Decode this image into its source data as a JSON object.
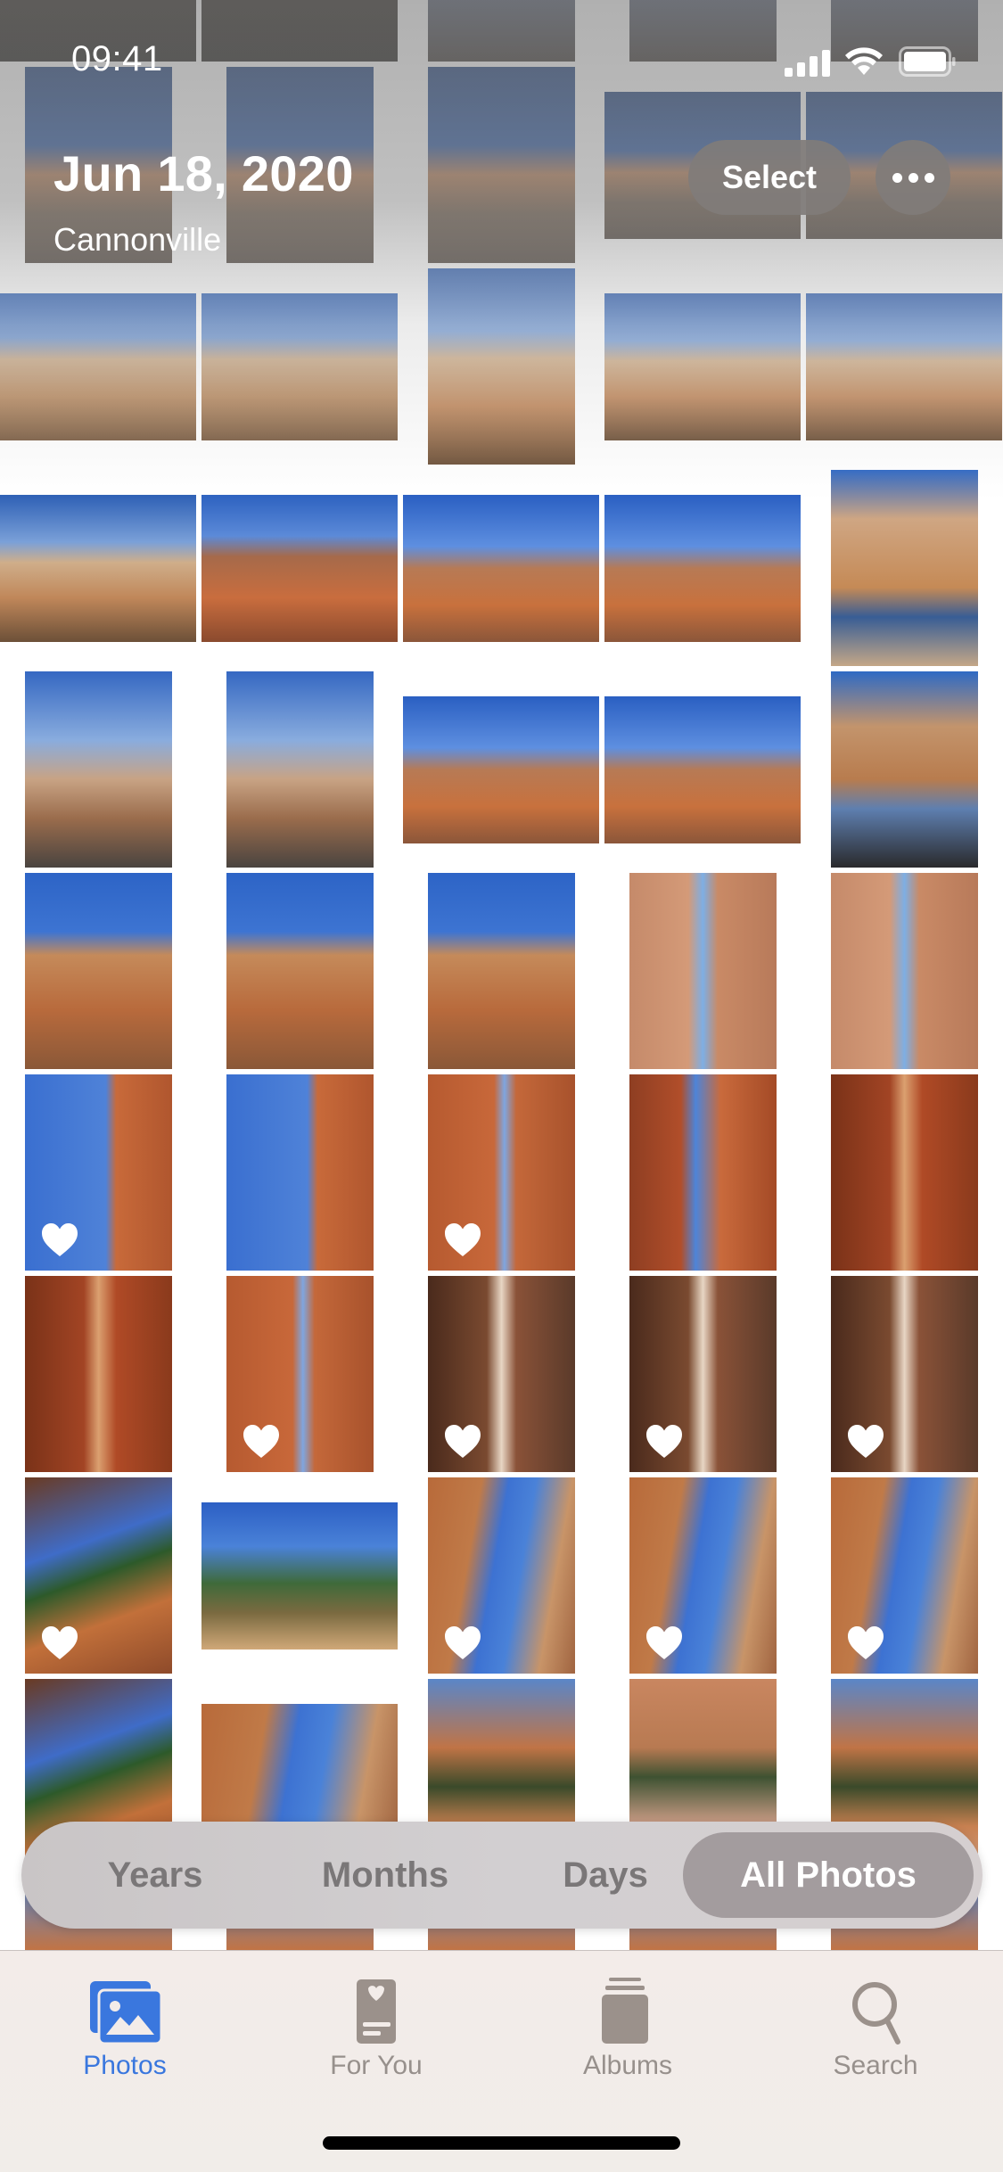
{
  "status_bar": {
    "time": "09:41",
    "signal_icon": "cellular-signal-icon",
    "wifi_icon": "wifi-icon",
    "battery_icon": "battery-icon"
  },
  "header": {
    "date": "Jun 18, 2020",
    "location": "Cannonville",
    "select_label": "Select",
    "more_icon": "ellipsis-icon"
  },
  "grid": {
    "photos": [
      {
        "row": -1,
        "col": 0,
        "fit": "full",
        "scene": "dusk-ground",
        "favorite": false
      },
      {
        "row": -1,
        "col": 1,
        "fit": "full",
        "scene": "dusk-ground",
        "favorite": false
      },
      {
        "row": -1,
        "col": 2,
        "fit": "portrait",
        "scene": "person-log",
        "favorite": false
      },
      {
        "row": -1,
        "col": 3,
        "fit": "portrait",
        "scene": "person-log",
        "favorite": false
      },
      {
        "row": -1,
        "col": 4,
        "fit": "portrait",
        "scene": "person-log",
        "favorite": false
      },
      {
        "row": 0,
        "col": 0,
        "fit": "portrait",
        "scene": "person-overlook",
        "favorite": false
      },
      {
        "row": 0,
        "col": 1,
        "fit": "portrait",
        "scene": "person-overlook",
        "favorite": false
      },
      {
        "row": 0,
        "col": 2,
        "fit": "portrait",
        "scene": "person-overlook",
        "favorite": false
      },
      {
        "row": 0,
        "col": 3,
        "fit": "landscape",
        "scene": "person-overlook",
        "favorite": false
      },
      {
        "row": 0,
        "col": 4,
        "fit": "landscape",
        "scene": "person-overlook",
        "favorite": false
      },
      {
        "row": 1,
        "col": 0,
        "fit": "landscape",
        "scene": "amphitheater-person",
        "favorite": false
      },
      {
        "row": 1,
        "col": 1,
        "fit": "landscape",
        "scene": "amphitheater-person",
        "favorite": false
      },
      {
        "row": 1,
        "col": 2,
        "fit": "portrait",
        "scene": "amphitheater",
        "favorite": false
      },
      {
        "row": 1,
        "col": 3,
        "fit": "landscape",
        "scene": "amphitheater",
        "favorite": false
      },
      {
        "row": 1,
        "col": 4,
        "fit": "landscape",
        "scene": "amphitheater",
        "favorite": false
      },
      {
        "row": 2,
        "col": 0,
        "fit": "landscape",
        "scene": "amphitheater",
        "favorite": false
      },
      {
        "row": 2,
        "col": 1,
        "fit": "landscape",
        "scene": "hoodoo-wall",
        "favorite": false
      },
      {
        "row": 2,
        "col": 2,
        "fit": "landscape",
        "scene": "hoodoo-clouds",
        "favorite": false
      },
      {
        "row": 2,
        "col": 3,
        "fit": "landscape",
        "scene": "hoodoo-clouds",
        "favorite": false
      },
      {
        "row": 2,
        "col": 4,
        "fit": "portrait",
        "scene": "railing-view",
        "favorite": false
      },
      {
        "row": 3,
        "col": 0,
        "fit": "portrait",
        "scene": "trail-descent",
        "favorite": false
      },
      {
        "row": 3,
        "col": 1,
        "fit": "portrait",
        "scene": "trail-descent",
        "favorite": false
      },
      {
        "row": 3,
        "col": 2,
        "fit": "landscape",
        "scene": "hoodoo-clouds",
        "favorite": false
      },
      {
        "row": 3,
        "col": 3,
        "fit": "landscape",
        "scene": "hoodoo-clouds",
        "favorite": false
      },
      {
        "row": 3,
        "col": 4,
        "fit": "portrait",
        "scene": "two-people",
        "favorite": false
      },
      {
        "row": 4,
        "col": 0,
        "fit": "portrait",
        "scene": "canyon-sky",
        "favorite": false
      },
      {
        "row": 4,
        "col": 1,
        "fit": "portrait",
        "scene": "canyon-sky",
        "favorite": false
      },
      {
        "row": 4,
        "col": 2,
        "fit": "portrait",
        "scene": "canyon-sky",
        "favorite": false
      },
      {
        "row": 4,
        "col": 3,
        "fit": "portrait",
        "scene": "slot-rock",
        "favorite": false
      },
      {
        "row": 4,
        "col": 4,
        "fit": "portrait",
        "scene": "slot-rock",
        "favorite": false
      },
      {
        "row": 5,
        "col": 0,
        "fit": "portrait",
        "scene": "slot-blue",
        "favorite": true
      },
      {
        "row": 5,
        "col": 1,
        "fit": "portrait",
        "scene": "slot-blue",
        "favorite": false
      },
      {
        "row": 5,
        "col": 2,
        "fit": "portrait",
        "scene": "slot-orange",
        "favorite": true
      },
      {
        "row": 5,
        "col": 3,
        "fit": "portrait",
        "scene": "slot-narrow",
        "favorite": false
      },
      {
        "row": 5,
        "col": 4,
        "fit": "portrait",
        "scene": "slot-dark",
        "favorite": false
      },
      {
        "row": 6,
        "col": 0,
        "fit": "portrait",
        "scene": "slot-dark",
        "favorite": false
      },
      {
        "row": 6,
        "col": 1,
        "fit": "portrait",
        "scene": "slot-orange",
        "favorite": true
      },
      {
        "row": 6,
        "col": 2,
        "fit": "portrait",
        "scene": "slot-shade",
        "favorite": true
      },
      {
        "row": 6,
        "col": 3,
        "fit": "portrait",
        "scene": "slot-shade",
        "favorite": true
      },
      {
        "row": 6,
        "col": 4,
        "fit": "portrait",
        "scene": "slot-shade",
        "favorite": true
      },
      {
        "row": 7,
        "col": 0,
        "fit": "portrait",
        "scene": "tree-canyon",
        "favorite": true
      },
      {
        "row": 7,
        "col": 1,
        "fit": "landscape",
        "scene": "forest-trail",
        "favorite": false
      },
      {
        "row": 7,
        "col": 2,
        "fit": "portrait",
        "scene": "hoodoo-spires",
        "favorite": true
      },
      {
        "row": 7,
        "col": 3,
        "fit": "portrait",
        "scene": "hoodoo-spires",
        "favorite": true
      },
      {
        "row": 7,
        "col": 4,
        "fit": "portrait",
        "scene": "hoodoo-spires",
        "favorite": true
      },
      {
        "row": 8,
        "col": 0,
        "fit": "portrait",
        "scene": "tree-canyon",
        "favorite": false
      },
      {
        "row": 8,
        "col": 1,
        "fit": "landscape",
        "scene": "hoodoo-spires",
        "favorite": false
      },
      {
        "row": 8,
        "col": 2,
        "fit": "portrait",
        "scene": "pine-canyon",
        "favorite": false
      },
      {
        "row": 8,
        "col": 3,
        "fit": "portrait",
        "scene": "trail-person",
        "favorite": false
      },
      {
        "row": 8,
        "col": 4,
        "fit": "portrait",
        "scene": "pine-canyon",
        "favorite": false
      },
      {
        "row": 9,
        "col": 0,
        "fit": "portrait",
        "scene": "pine-canyon",
        "favorite": false
      },
      {
        "row": 9,
        "col": 1,
        "fit": "portrait",
        "scene": "pine-canyon",
        "favorite": false
      },
      {
        "row": 9,
        "col": 2,
        "fit": "portrait",
        "scene": "pine-canyon",
        "favorite": false
      },
      {
        "row": 9,
        "col": 3,
        "fit": "portrait",
        "scene": "pine-canyon",
        "favorite": false
      },
      {
        "row": 9,
        "col": 4,
        "fit": "portrait",
        "scene": "pine-canyon",
        "favorite": false
      }
    ]
  },
  "view_switcher": {
    "options": [
      {
        "label": "Years",
        "selected": false
      },
      {
        "label": "Months",
        "selected": false
      },
      {
        "label": "Days",
        "selected": false
      },
      {
        "label": "All Photos",
        "selected": true
      }
    ]
  },
  "tab_bar": {
    "tabs": [
      {
        "label": "Photos",
        "icon": "photos-icon",
        "selected": true
      },
      {
        "label": "For You",
        "icon": "for-you-icon",
        "selected": false
      },
      {
        "label": "Albums",
        "icon": "albums-icon",
        "selected": false
      },
      {
        "label": "Search",
        "icon": "search-icon",
        "selected": false
      }
    ]
  },
  "colors": {
    "accent": "#3a77de",
    "tab_inactive": "#97908c",
    "segment_selected_bg": "#a39c9e",
    "overlay_button_bg": "#807c7a"
  }
}
